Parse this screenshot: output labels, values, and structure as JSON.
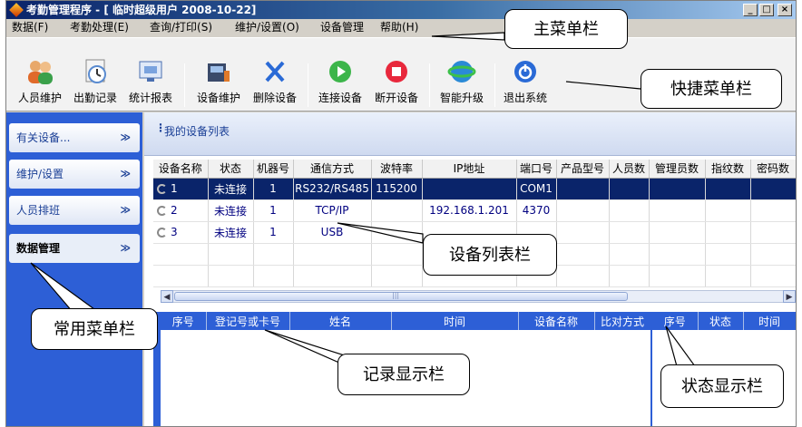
{
  "window": {
    "title": "考勤管理程序 - [ 临时超级用户  2008-10-22]",
    "btn_min": "_",
    "btn_max": "□",
    "btn_close": "×"
  },
  "menu": {
    "items": [
      "数据(F)",
      "考勤处理(E)",
      "查询/打印(S)",
      "维护/设置(O)",
      "设备管理",
      "帮助(H)"
    ]
  },
  "toolbar": {
    "items": [
      "人员维护",
      "出勤记录",
      "统计报表",
      "设备维护",
      "删除设备",
      "连接设备",
      "断开设备",
      "智能升级",
      "退出系统"
    ]
  },
  "sidebar": {
    "items": [
      "有关设备...",
      "维护/设置",
      "人员排班",
      "数据管理"
    ],
    "chevron": "≫"
  },
  "device_list": {
    "title": "我的设备列表",
    "columns": [
      "设备名称",
      "状态",
      "机器号",
      "通信方式",
      "波特率",
      "IP地址",
      "端口号",
      "产品型号",
      "人员数",
      "管理员数",
      "指纹数",
      "密码数"
    ],
    "rows": [
      {
        "name": "1",
        "status": "未连接",
        "machine": "1",
        "comm": "RS232/RS485",
        "baud": "115200",
        "ip": "",
        "port": "COM1"
      },
      {
        "name": "2",
        "status": "未连接",
        "machine": "1",
        "comm": "TCP/IP",
        "baud": "",
        "ip": "192.168.1.201",
        "port": "4370"
      },
      {
        "name": "3",
        "status": "未连接",
        "machine": "1",
        "comm": "USB",
        "baud": "",
        "ip": "",
        "port": ""
      }
    ]
  },
  "scrollbar": {
    "left": "◀",
    "right": "▶",
    "grip": "|||"
  },
  "records": {
    "columns": [
      "序号",
      "登记号或卡号",
      "姓名",
      "时间",
      "设备名称",
      "比对方式"
    ]
  },
  "status_panel": {
    "columns": [
      "序号",
      "状态",
      "时间"
    ]
  },
  "callouts": {
    "main_menu": "主菜单栏",
    "quick_menu": "快捷菜单栏",
    "device_list": "设备列表栏",
    "common_menu": "常用菜单栏",
    "record_display": "记录显示栏",
    "status_display": "状态显示栏"
  }
}
